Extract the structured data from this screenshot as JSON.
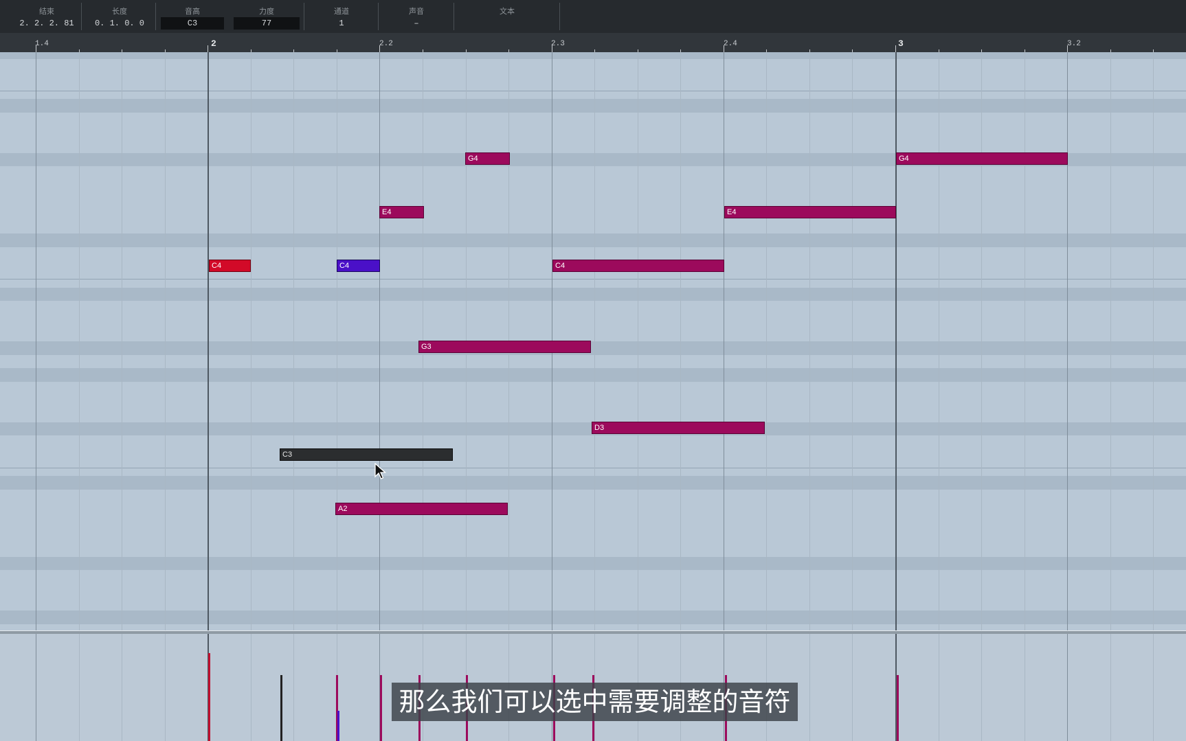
{
  "info_bar": {
    "fields": [
      {
        "label": "结束",
        "value": "2. 2. 2. 81"
      },
      {
        "label": "长度",
        "value": "0. 1. 0.   0"
      },
      {
        "label": "音高",
        "value": "C3"
      },
      {
        "label": "力度",
        "value": "77"
      },
      {
        "label": "通道",
        "value": "1"
      },
      {
        "label": "声音",
        "value": "–"
      },
      {
        "label": "文本",
        "value": ""
      }
    ]
  },
  "ruler": {
    "labels": [
      "1.4",
      "2",
      "2.2",
      "2.3",
      "2.4",
      "3",
      "3.2"
    ]
  },
  "notes": [
    {
      "name": "G4",
      "pitch": "G4",
      "start": "2.2.3",
      "end": "2.2.4",
      "color": "#9c0a5c"
    },
    {
      "name": "G4",
      "pitch": "G4",
      "start": "3.1.1",
      "end": "3.2.1",
      "color": "#9c0a5c"
    },
    {
      "name": "E4",
      "pitch": "E4",
      "start": "2.2.1",
      "end": "2.2.2",
      "color": "#9c0a5c"
    },
    {
      "name": "E4",
      "pitch": "E4",
      "start": "2.4.1",
      "end": "3.1.1",
      "color": "#9c0a5c"
    },
    {
      "name": "C4",
      "pitch": "C4",
      "start": "2.1.1",
      "end": "2.1.2",
      "color": "#d20a28",
      "state": "red"
    },
    {
      "name": "C4",
      "pitch": "C4",
      "start": "2.1.4",
      "end": "2.2.1",
      "color": "#4a10c8",
      "state": "blue"
    },
    {
      "name": "C4",
      "pitch": "C4",
      "start": "2.3.1",
      "end": "2.4.1",
      "color": "#9c0a5c"
    },
    {
      "name": "G3",
      "pitch": "G3",
      "start": "2.2.2",
      "end": "2.3.2",
      "color": "#9c0a5c"
    },
    {
      "name": "D3",
      "pitch": "D3",
      "start": "2.3.2",
      "end": "2.4.2",
      "color": "#9c0a5c"
    },
    {
      "name": "C3",
      "pitch": "C3",
      "start": "2.1.3",
      "end": "2.2.3",
      "color": "#2b2d2f",
      "state": "dark"
    },
    {
      "name": "A2",
      "pitch": "A2",
      "start": "2.1.4",
      "end": "2.2.4",
      "color": "#9c0a5c"
    }
  ],
  "velocity_lane": {
    "color": "#9c0a5c"
  },
  "subtitle": "那么我们可以选中需要调整的音符",
  "colors": {
    "note": "#9c0a5c",
    "note_red": "#d20a28",
    "note_blue": "#4a10c8",
    "note_dark": "#2b2d2f",
    "grid_bg": "#b9c8d6",
    "grid_stripe": "#a9b9c8",
    "toolbar": "#262a2e"
  }
}
